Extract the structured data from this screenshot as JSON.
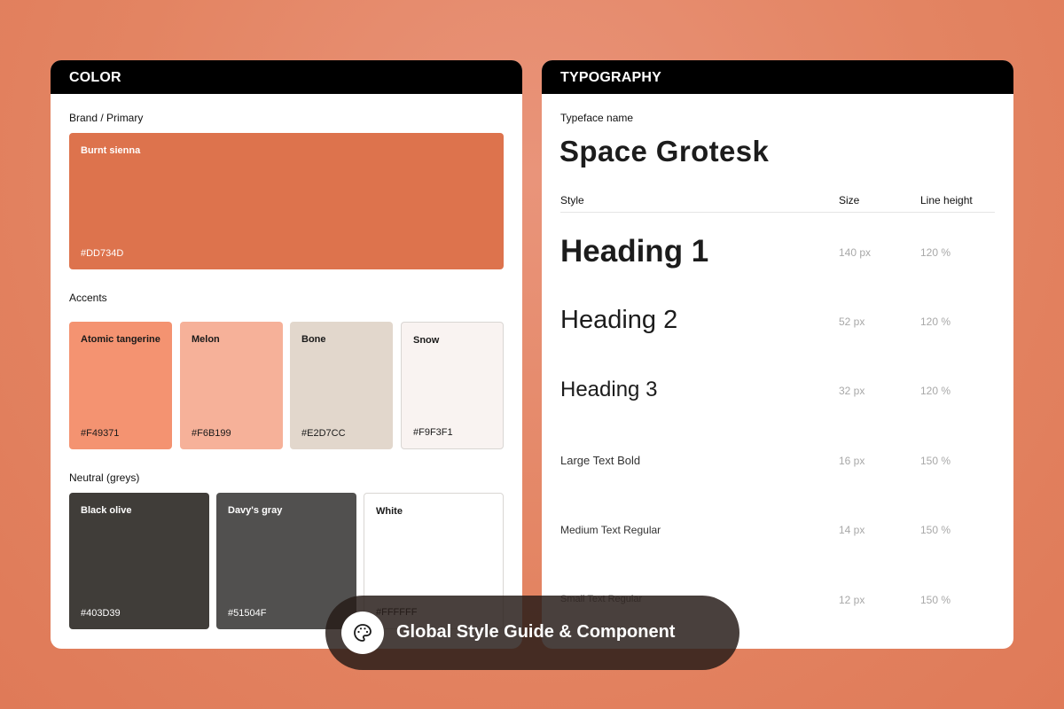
{
  "color_panel": {
    "title": "COLOR",
    "brand_label": "Brand / Primary",
    "brand": {
      "name": "Burnt sienna",
      "hex": "#DD734D",
      "color": "#DD734D"
    },
    "accents_label": "Accents",
    "accents": [
      {
        "name": "Atomic tangerine",
        "hex": "#F49371",
        "color": "#F49371"
      },
      {
        "name": "Melon",
        "hex": "#F6B199",
        "color": "#F6B199"
      },
      {
        "name": "Bone",
        "hex": "#E2D7CC",
        "color": "#E2D7CC"
      },
      {
        "name": "Snow",
        "hex": "#F9F3F1",
        "color": "#F9F3F1"
      }
    ],
    "neutral_label": "Neutral (greys)",
    "neutrals": [
      {
        "name": "Black olive",
        "hex": "#403D39",
        "color": "#403D39"
      },
      {
        "name": "Davy's gray",
        "hex": "#51504F",
        "color": "#51504F"
      },
      {
        "name": "White",
        "hex": "#FFFFFF",
        "color": "#FFFFFF"
      }
    ]
  },
  "typography_panel": {
    "title": "TYPOGRAPHY",
    "typeface_label": "Typeface name",
    "typeface_name": "Space Grotesk",
    "columns": {
      "style": "Style",
      "size": "Size",
      "line_height": "Line height"
    },
    "rows": [
      {
        "style": "Heading 1",
        "size": "140 px",
        "line_height": "120 %"
      },
      {
        "style": "Heading 2",
        "size": "52 px",
        "line_height": "120 %"
      },
      {
        "style": "Heading 3",
        "size": "32 px",
        "line_height": "120 %"
      },
      {
        "style": "Large Text Bold",
        "size": "16 px",
        "line_height": "150 %"
      },
      {
        "style": "Medium Text Regular",
        "size": "14 px",
        "line_height": "150 %"
      },
      {
        "style": "Small Text Regular",
        "size": "12 px",
        "line_height": "150 %"
      }
    ]
  },
  "badge": {
    "icon": "palette-icon",
    "label": "Global Style Guide & Component"
  }
}
